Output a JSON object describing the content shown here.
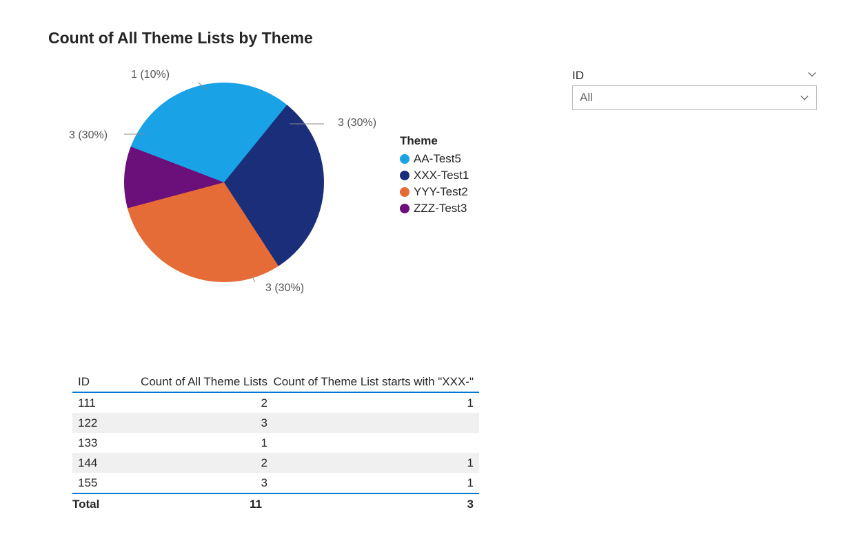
{
  "title": "Count of All Theme Lists by Theme",
  "chart_data": {
    "type": "pie",
    "title": "Count of All Theme Lists by Theme",
    "series": [
      {
        "name": "AA-Test5",
        "value": 3,
        "percent": 30,
        "color": "#1aa2e6",
        "label": "3 (30%)"
      },
      {
        "name": "XXX-Test1",
        "value": 3,
        "percent": 30,
        "color": "#1b2e7a",
        "label": "3 (30%)"
      },
      {
        "name": "YYY-Test2",
        "value": 3,
        "percent": 30,
        "color": "#e66c37",
        "label": "3 (30%)"
      },
      {
        "name": "ZZZ-Test3",
        "value": 1,
        "percent": 10,
        "color": "#6b0f7a",
        "label": "1 (10%)"
      }
    ],
    "legend_title": "Theme"
  },
  "legend": {
    "title": "Theme",
    "items": [
      {
        "label": "AA-Test5",
        "color": "#1aa2e6"
      },
      {
        "label": "XXX-Test1",
        "color": "#1b2e7a"
      },
      {
        "label": "YYY-Test2",
        "color": "#e66c37"
      },
      {
        "label": "ZZZ-Test3",
        "color": "#6b0f7a"
      }
    ]
  },
  "callouts": {
    "c0": "3 (30%)",
    "c1": "3 (30%)",
    "c2": "3 (30%)",
    "c3": "1 (10%)"
  },
  "slicer": {
    "title": "ID",
    "value": "All"
  },
  "table": {
    "headers": {
      "h1": "ID",
      "h2": "Count of All Theme Lists",
      "h3": "Count of Theme List starts with \"XXX-\""
    },
    "rows": [
      {
        "id": "111",
        "count": "2",
        "xxx": "1"
      },
      {
        "id": "122",
        "count": "3",
        "xxx": ""
      },
      {
        "id": "133",
        "count": "1",
        "xxx": ""
      },
      {
        "id": "144",
        "count": "2",
        "xxx": "1"
      },
      {
        "id": "155",
        "count": "3",
        "xxx": "1"
      }
    ],
    "total": {
      "label": "Total",
      "count": "11",
      "xxx": "3"
    }
  }
}
